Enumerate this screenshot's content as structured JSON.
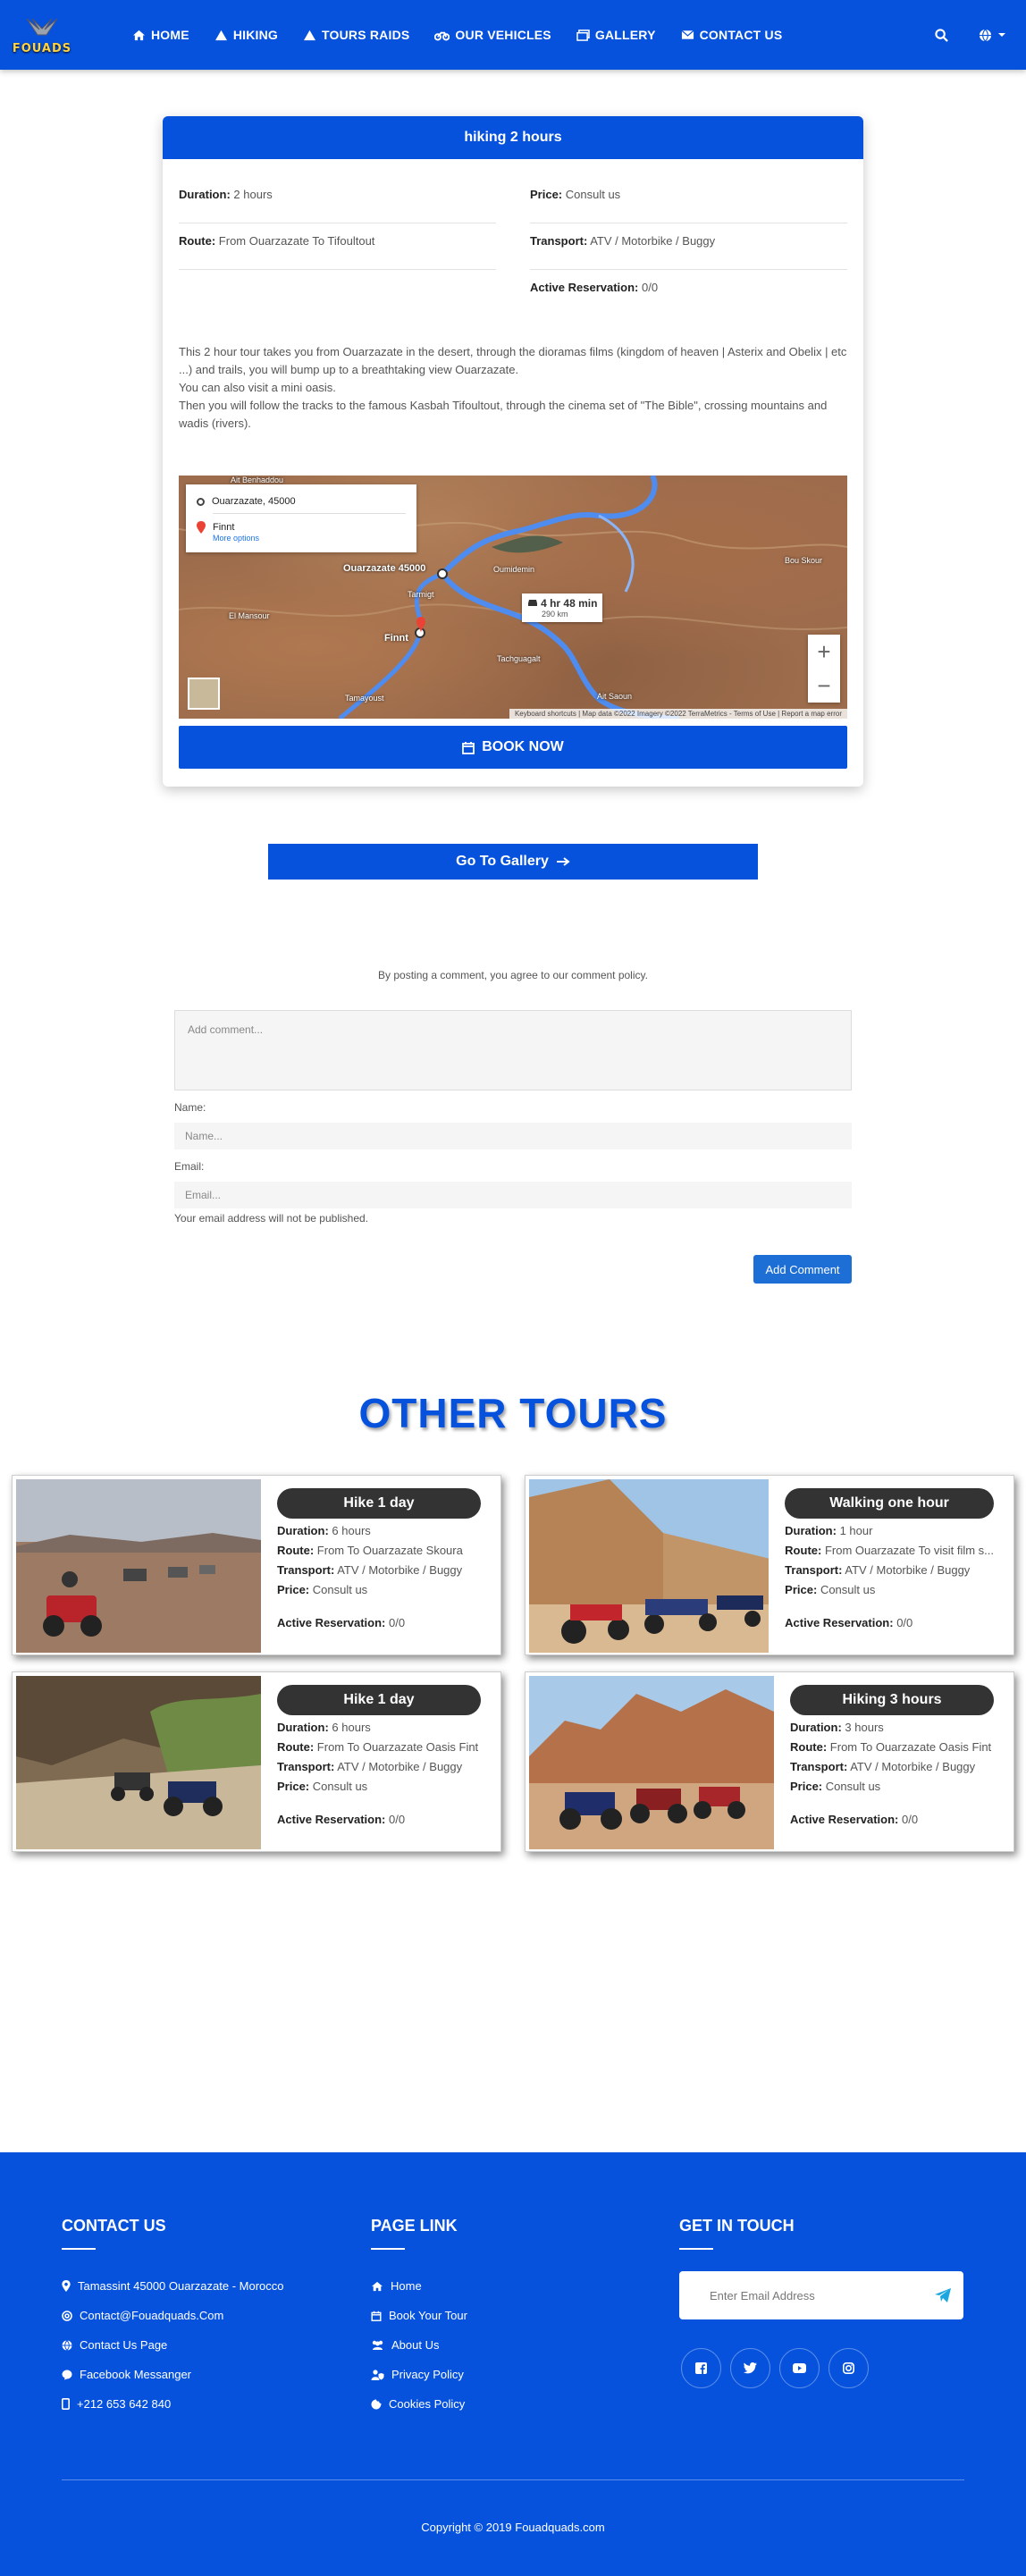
{
  "nav": {
    "logo_text": "FOUADS",
    "items": [
      {
        "label": "HOME",
        "icon": "home-icon"
      },
      {
        "label": "HIKING",
        "icon": "triangle-icon"
      },
      {
        "label": "TOURS RAIDS",
        "icon": "triangle-icon"
      },
      {
        "label": "OUR VEHICLES",
        "icon": "motorcycle-icon"
      },
      {
        "label": "GALLERY",
        "icon": "images-icon"
      },
      {
        "label": "CONTACT US",
        "icon": "envelope-icon"
      }
    ]
  },
  "tour": {
    "title": "hiking 2 hours",
    "duration_label": "Duration:",
    "duration": "2 hours",
    "price_label": "Price:",
    "price": "Consult us",
    "route_label": "Route:",
    "route": "From Ouarzazate To Tifoultout",
    "transport_label": "Transport:",
    "transport": "ATV / Motorbike / Buggy",
    "reservation_label": "Active Reservation:",
    "reservation": "0/0",
    "description": [
      "This 2 hour tour takes you from Ouarzazate in the desert, through the dioramas films (kingdom of heaven | Asterix and Obelix | etc ...) and trails, you will bump up to a breathtaking view Ouarzazate.",
      "You can also visit a mini oasis.",
      "Then you will follow the tracks to the famous Kasbah Tifoultout, through the cinema set of \"The Bible\", crossing mountains and wadis (rivers)."
    ],
    "map": {
      "origin": "Ouarzazate, 45000",
      "destination": "Finnt",
      "more_options": "More options",
      "duration": "4 hr 48 min",
      "distance": "290 km",
      "footer": "Keyboard shortcuts | Map data ©2022 Imagery ©2022 TerraMetrics - Terms of Use | Report a map error",
      "labels": {
        "city": "Ouarzazate 45000",
        "finnt": "Finnt",
        "tarmigt": "Tarmigt",
        "ouisselsate": "Ait Benhaddou",
        "oumidemin": "Oumidemin",
        "tachguagalt": "Tachguagalt",
        "bou_skour": "Bou Skour",
        "el_mansour": "El Mansour",
        "ait_saoun": "Ait Saoun",
        "tamayoust": "Tamayoust"
      }
    },
    "book_label": "BOOK NOW"
  },
  "gallery_label": "Go To Gallery",
  "comments": {
    "policy": "By posting a comment, you agree to our comment policy.",
    "comment_placeholder": "Add comment...",
    "name_label": "Name:",
    "name_placeholder": "Name...",
    "email_label": "Email:",
    "email_placeholder": "Email...",
    "email_note": "Your email address will not be published.",
    "submit_label": "Add Comment"
  },
  "other_tours": {
    "title": "OTHER TOURS",
    "labels": {
      "duration": "Duration:",
      "route": "Route:",
      "transport": "Transport:",
      "price": "Price:",
      "reservation": "Active Reservation:"
    },
    "items": [
      {
        "name": "Hike 1 day",
        "duration": "6 hours",
        "route": "From To Ouarzazate Skoura",
        "transport": "ATV / Motorbike / Buggy",
        "price": "Consult us",
        "reservation": "0/0"
      },
      {
        "name": "Walking one hour",
        "duration": "1 hour",
        "route": "From Ouarzazate To visit film s...",
        "transport": "ATV / Motorbike / Buggy",
        "price": "Consult us",
        "reservation": "0/0"
      },
      {
        "name": "Hike 1 day",
        "duration": "6 hours",
        "route": "From To Ouarzazate Oasis Fint",
        "transport": "ATV / Motorbike / Buggy",
        "price": "Consult us",
        "reservation": "0/0"
      },
      {
        "name": "Hiking 3 hours",
        "duration": "3 hours",
        "route": "From To Ouarzazate Oasis Fint",
        "transport": "ATV / Motorbike / Buggy",
        "price": "Consult us",
        "reservation": "0/0"
      }
    ]
  },
  "footer": {
    "contact_title": "CONTACT US",
    "contact": [
      "Tamassint 45000 Ouarzazate - Morocco",
      "Contact@Fouadquads.Com",
      "Contact Us Page",
      "Facebook Messanger",
      "+212 653 642 840"
    ],
    "links_title": "PAGE LINK",
    "links": [
      "Home",
      "Book Your Tour",
      "About Us",
      "Privacy Policy",
      "Cookies Policy"
    ],
    "touch_title": "GET IN TOUCH",
    "email_placeholder": "Enter Email Address",
    "copyright": "Copyright © 2019 Fouadquads.com"
  },
  "colors": {
    "brand": "#0652dd",
    "dark_pill": "#333333",
    "button": "#1d6fd6"
  }
}
